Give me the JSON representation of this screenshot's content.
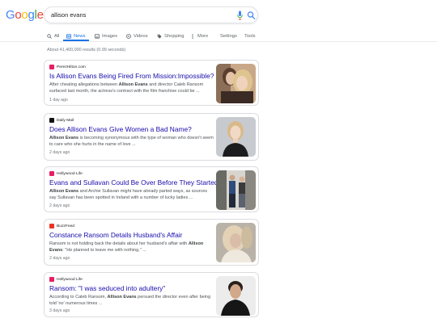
{
  "search": {
    "query": "allison evans"
  },
  "logo": {
    "letters": [
      "G",
      "o",
      "o",
      "g",
      "l",
      "e"
    ],
    "colors": [
      "#4285F4",
      "#EA4335",
      "#FBBC05",
      "#4285F4",
      "#34A853",
      "#EA4335"
    ]
  },
  "tabs": [
    {
      "label": "All",
      "icon": "search-icon"
    },
    {
      "label": "News",
      "icon": "news-icon",
      "active": true
    },
    {
      "label": "Images",
      "icon": "image-icon"
    },
    {
      "label": "Videos",
      "icon": "video-icon"
    },
    {
      "label": "Shopping",
      "icon": "tag-icon"
    },
    {
      "label": "More",
      "icon": "more-icon"
    }
  ],
  "tools": {
    "settings": "Settings",
    "tools": "Tools"
  },
  "stats": "About 41,400,000 results (0.99 seconds)",
  "results": [
    {
      "source": "PerezHilton.com",
      "title": "Is Allison Evans Being Fired From Mission:Impossible?",
      "snippet_pre": "After cheating allegations between ",
      "snippet_bold": "Allison Evans",
      "snippet_post": " and director Caleb Ransom surfaced last month, the actress's contract with the film franchise could be ...",
      "date": "1 day ago",
      "fav_color": "#e91e63"
    },
    {
      "source": "Daily Mail",
      "title": "Does Allison Evans Give Women a Bad Name?",
      "snippet_pre": "",
      "snippet_bold": "Allison Evans",
      "snippet_post": " is becoming synonymous with the type of woman who doesn't seem to care who she hurts in the name of love ...",
      "date": "2 days ago",
      "fav_color": "#111111"
    },
    {
      "source": "Hollywood Life",
      "title": "Evans and Sullavan Could Be Over Before They Started",
      "snippet_pre": "",
      "snippet_bold": "Allison Evans",
      "snippet_post": " and Archie Sullavan might have already parted ways, as sources say Sullavan has been spotted in Ireland with a number of lucky ladies ...",
      "date": "2 days ago",
      "fav_color": "#e91e63"
    },
    {
      "source": "BuzzFeed",
      "title": "Constance Ransom Details Husband's Affair",
      "snippet_pre": "Ransom is not holding back the details about her husband's affair with ",
      "snippet_bold": "Allison Evans",
      "snippet_post": ": \"He planned to leave me with nothing.\" ...",
      "date": "2 days ago",
      "fav_color": "#ee3322"
    },
    {
      "source": "Hollywood Life",
      "title": "Ransom: \"I was seduced into adultery\"",
      "snippet_pre": "According to Caleb Ransom, ",
      "snippet_bold": "Allison Evans",
      "snippet_post": " persued the director even after being told 'no' numerous times ...",
      "date": "3 days ago",
      "fav_color": "#e91e63"
    }
  ]
}
